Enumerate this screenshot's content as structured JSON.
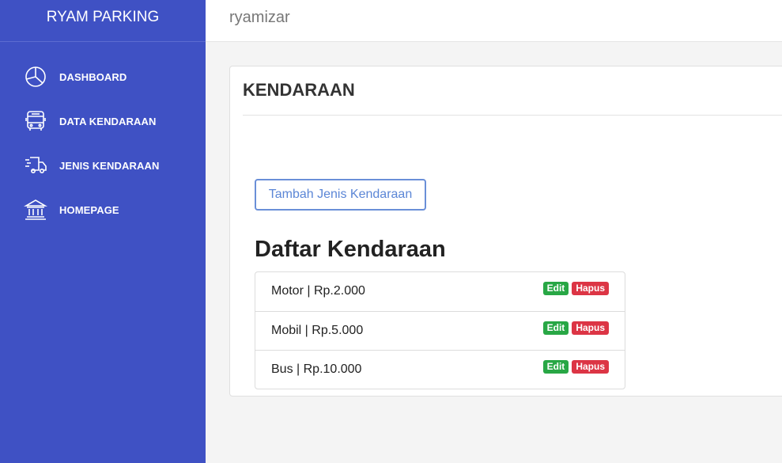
{
  "sidebar": {
    "brand": "RYAM PARKING",
    "items": [
      {
        "label": "DASHBOARD",
        "icon": "pie-chart-icon"
      },
      {
        "label": "DATA KENDARAAN",
        "icon": "bus-icon"
      },
      {
        "label": "JENIS KENDARAAN",
        "icon": "delivery-truck-icon"
      },
      {
        "label": "HOMEPAGE",
        "icon": "bank-icon"
      }
    ]
  },
  "topbar": {
    "username": "ryamizar"
  },
  "card": {
    "title": "KENDARAAN",
    "add_button": "Tambah Jenis Kendaraan",
    "list_title": "Daftar Kendaraan",
    "items": [
      {
        "text": "Motor | Rp.2.000",
        "edit": "Edit",
        "delete": "Hapus"
      },
      {
        "text": "Mobil | Rp.5.000",
        "edit": "Edit",
        "delete": "Hapus"
      },
      {
        "text": "Bus | Rp.10.000",
        "edit": "Edit",
        "delete": "Hapus"
      }
    ]
  },
  "colors": {
    "sidebar": "#3f51c4",
    "edit": "#28a745",
    "delete": "#dc3545",
    "accent": "#5b86d6"
  }
}
